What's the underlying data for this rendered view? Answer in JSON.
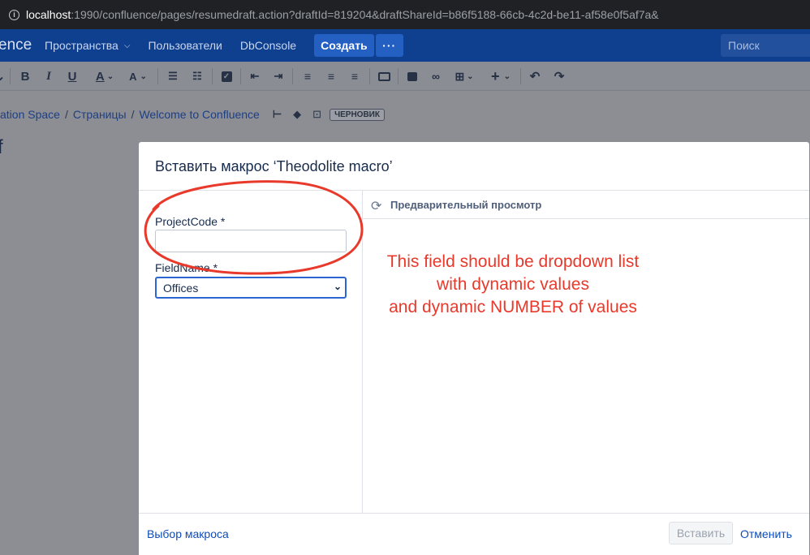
{
  "browser": {
    "url_host": "localhost",
    "url_rest": ":1990/confluence/pages/resumedraft.action?draftId=819204&draftShareId=b86f5188-66cb-4c2d-be11-af58e0f5af7a&"
  },
  "header": {
    "logo": "ence",
    "spaces": "Пространства",
    "users": "Пользователи",
    "dbconsole": "DbConsole",
    "create": "Создать",
    "more": "···",
    "search_placeholder": "Поиск"
  },
  "breadcrumbs": {
    "items": [
      "ation Space",
      "Страницы",
      "Welcome to Confluence"
    ],
    "separator": "/",
    "draft_badge": "ЧЕРНОВИК"
  },
  "page_title_fragment": "f",
  "dialog": {
    "title": "Вставить макрос ‘Theodolite macro’",
    "fields": {
      "project_code_label": "ProjectCode *",
      "project_code_value": "",
      "field_name_label": "FieldName *",
      "field_name_value": "Offices"
    },
    "preview_label": "Предварительный просмотр",
    "footer": {
      "select_macro": "Выбор макроса",
      "insert": "Вставить",
      "cancel": "Отменить"
    }
  },
  "annotation": {
    "lines": [
      "This field should be dropdown list",
      "with dynamic values",
      "and dynamic NUMBER of values"
    ],
    "color": "#e8392b"
  },
  "colors": {
    "header_bg": "#0f3f8f",
    "create_button": "#245fc2",
    "link": "#0c4db8",
    "focus_border": "#2c67d1"
  }
}
